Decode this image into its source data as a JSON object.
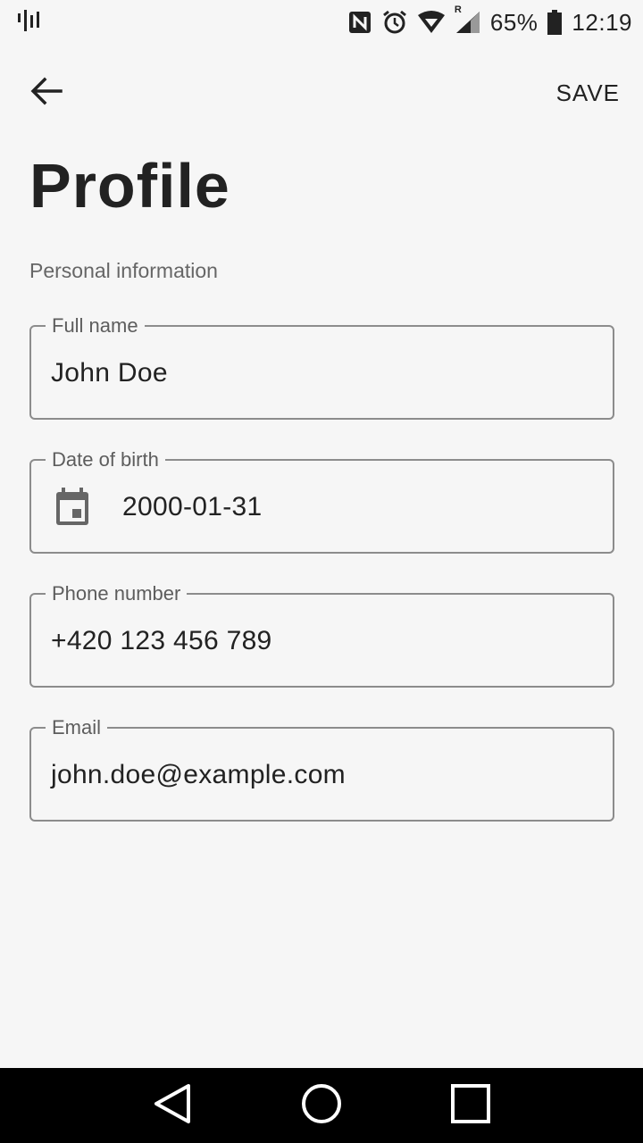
{
  "status_bar": {
    "icons": [
      "signal-bars-icon",
      "nfc-icon",
      "alarm-icon",
      "wifi-icon",
      "roaming-r-icon",
      "cell-signal-icon",
      "battery-icon"
    ],
    "roaming_indicator": "R",
    "battery_percent": "65%",
    "time": "12:19"
  },
  "app_bar": {
    "back_icon": "arrow-left-icon",
    "save_label": "SAVE"
  },
  "page": {
    "title": "Profile",
    "section_label": "Personal information"
  },
  "fields": {
    "full_name": {
      "label": "Full name",
      "value": "John Doe"
    },
    "date_of_birth": {
      "label": "Date of birth",
      "value": "2000-01-31",
      "icon": "calendar-icon"
    },
    "phone_number": {
      "label": "Phone number",
      "value": "+420 123 456 789"
    },
    "email": {
      "label": "Email",
      "value": "john.doe@example.com"
    }
  },
  "nav_bar": {
    "icons": [
      "back-triangle-icon",
      "home-circle-icon",
      "recents-square-icon"
    ]
  },
  "colors": {
    "background": "#f6f6f6",
    "text": "#222222",
    "field_border": "#8c8c8c",
    "nav_bar": "#000000"
  }
}
